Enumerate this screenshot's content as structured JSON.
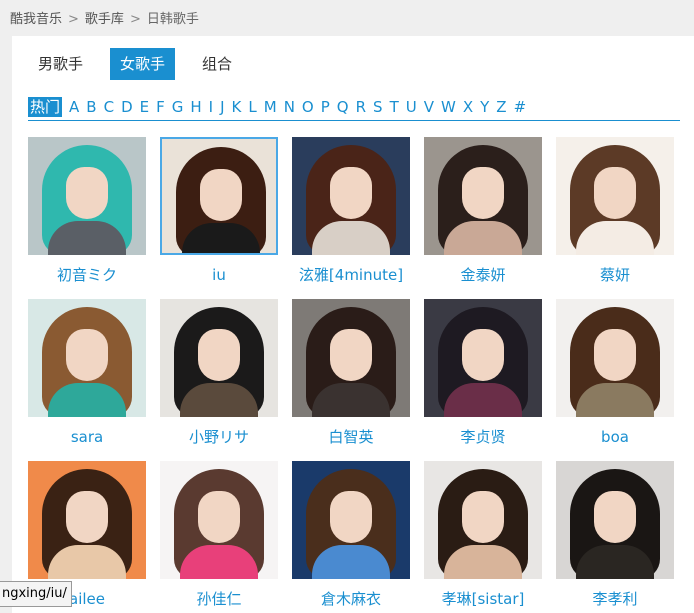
{
  "breadcrumb": [
    "酷我音乐",
    "歌手库",
    "日韩歌手"
  ],
  "breadcrumb_sep": ">",
  "tabs": [
    {
      "label": "男歌手",
      "active": false
    },
    {
      "label": "女歌手",
      "active": true
    },
    {
      "label": "组合",
      "active": false
    }
  ],
  "alpha": [
    "热门",
    "A",
    "B",
    "C",
    "D",
    "E",
    "F",
    "G",
    "H",
    "I",
    "J",
    "K",
    "L",
    "M",
    "N",
    "O",
    "P",
    "Q",
    "R",
    "S",
    "T",
    "U",
    "V",
    "W",
    "X",
    "Y",
    "Z",
    "#"
  ],
  "alpha_active": "热门",
  "artists": [
    {
      "name": "初音ミク",
      "bg": "#b9c6c8",
      "hair": "#2fb8ae",
      "body": "#5a5f66"
    },
    {
      "name": "iu",
      "bg": "#eae2d8",
      "hair": "#3c1e12",
      "body": "#1a1a1a",
      "selected": true
    },
    {
      "name": "泫雅[4minute]",
      "bg": "#2a3d5c",
      "hair": "#4a2418",
      "body": "#d8cfc6"
    },
    {
      "name": "金泰妍",
      "bg": "#9b958e",
      "hair": "#2b1f1b",
      "body": "#c9a896"
    },
    {
      "name": "蔡妍",
      "bg": "#f5f0ea",
      "hair": "#5c3a26",
      "body": "#f4ece4"
    },
    {
      "name": "sara",
      "bg": "#d8e8e6",
      "hair": "#8a5a32",
      "body": "#2ea89a"
    },
    {
      "name": "小野リサ",
      "bg": "#e6e4e0",
      "hair": "#1b1a1a",
      "body": "#5a4a3c"
    },
    {
      "name": "白智英",
      "bg": "#7e7a76",
      "hair": "#2a1c18",
      "body": "#3a3230"
    },
    {
      "name": "李贞贤",
      "bg": "#3a3a44",
      "hair": "#1e1a22",
      "body": "#6a2e48"
    },
    {
      "name": "boa",
      "bg": "#f2f0ee",
      "hair": "#4a2c1a",
      "body": "#8a7a60"
    },
    {
      "name": "ailee",
      "bg": "#f08a4a",
      "hair": "#3a2214",
      "body": "#e8c8a8"
    },
    {
      "name": "孙佳仁",
      "bg": "#f6f4f4",
      "hair": "#5a3a30",
      "body": "#e8407a"
    },
    {
      "name": "倉木麻衣",
      "bg": "#1a3a6a",
      "hair": "#4a2e1c",
      "body": "#4a8ad0"
    },
    {
      "name": "孝琳[sistar]",
      "bg": "#e8e6e4",
      "hair": "#2a1c14",
      "body": "#d8b49a"
    },
    {
      "name": "李孝利",
      "bg": "#d8d6d4",
      "hair": "#1a1614",
      "body": "#2a2622"
    }
  ],
  "status_url": "ngxing/iu/",
  "colors": {
    "accent": "#1a8fd0"
  }
}
